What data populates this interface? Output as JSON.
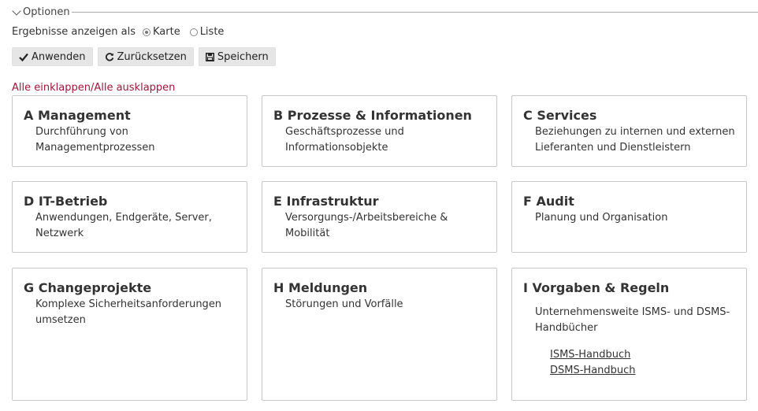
{
  "options": {
    "legend": "Optionen"
  },
  "display": {
    "label": "Ergebnisse anzeigen als",
    "modes": [
      {
        "label": "Karte",
        "checked": true
      },
      {
        "label": "Liste",
        "checked": false
      }
    ]
  },
  "buttons": {
    "apply": "Anwenden",
    "reset": "Zurücksetzen",
    "save": "Speichern"
  },
  "collapse_link": "Alle einklappen/Alle ausklappen",
  "accent_color": "#a0173a",
  "cards": [
    {
      "title": "A Management",
      "description": "Durchführung von Managementprozessen"
    },
    {
      "title": "B Prozesse & Informationen",
      "description": "Geschäftsprozesse und Informationsobjekte"
    },
    {
      "title": "C Services",
      "description": "Beziehungen zu internen und externen Lieferanten und Dienstleistern"
    },
    {
      "title": "D IT-Betrieb",
      "description": "Anwendungen, Endgeräte, Server, Netzwerk"
    },
    {
      "title": "E Infrastruktur",
      "description": "Versorgungs-/Arbeitsbereiche & Mobilität"
    },
    {
      "title": "F Audit",
      "description": "Planung und Organisation"
    },
    {
      "title": "G Changeprojekte",
      "description": "Komplexe Sicherheitsanforderungen umsetzen"
    },
    {
      "title": "H Meldungen",
      "description": "Störungen und Vorfälle"
    },
    {
      "title": "I Vorgaben & Regeln",
      "description": "Unternehmensweite ISMS- und DSMS-Handbücher",
      "links": [
        "ISMS-Handbuch",
        "DSMS-Handbuch"
      ]
    }
  ]
}
